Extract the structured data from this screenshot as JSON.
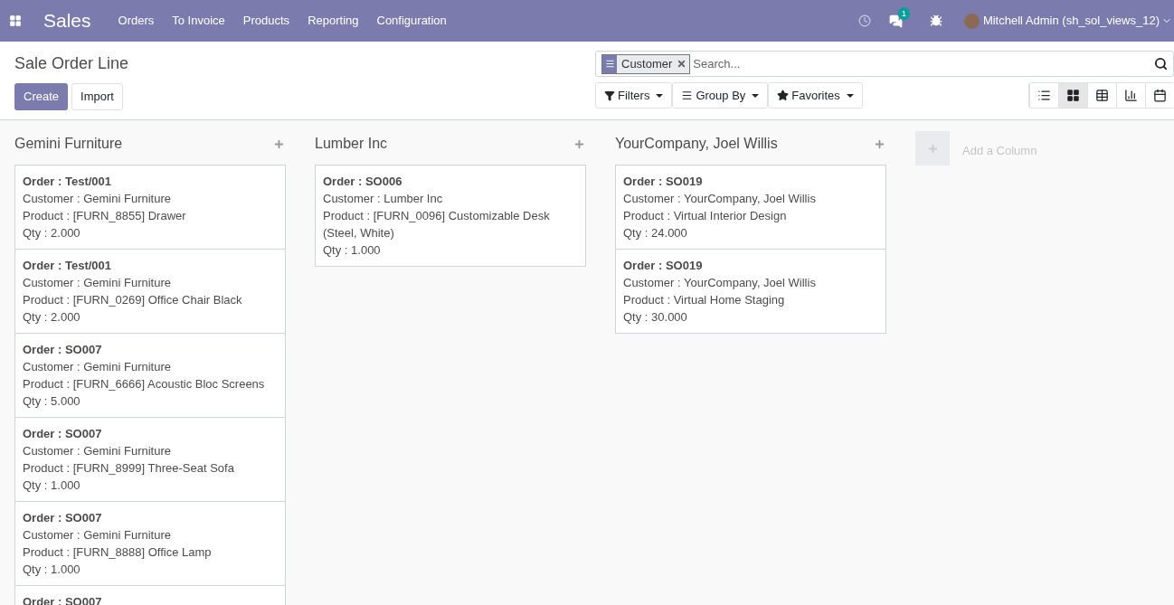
{
  "navbar": {
    "app": "Sales",
    "menu": [
      "Orders",
      "To Invoice",
      "Products",
      "Reporting",
      "Configuration"
    ],
    "messages_badge": "1",
    "user": "Mitchell Admin (sh_sol_views_12)"
  },
  "control_panel": {
    "title": "Sale Order Line",
    "buttons": [
      {
        "label": "Create",
        "kind": "primary"
      },
      {
        "label": "Import",
        "kind": "secondary"
      }
    ],
    "search": {
      "facets": [
        {
          "label": "Customer"
        }
      ],
      "placeholder": "Search..."
    },
    "dropdowns": [
      {
        "label": "Filters",
        "kind": "filter"
      },
      {
        "label": "Group By",
        "kind": "group"
      },
      {
        "label": "Favorites",
        "kind": "star"
      }
    ],
    "views": [
      {
        "kind": "list",
        "selected": false
      },
      {
        "kind": "kanban",
        "selected": true
      },
      {
        "kind": "pivot",
        "selected": false
      },
      {
        "kind": "graph",
        "selected": false
      },
      {
        "kind": "calendar",
        "selected": false
      }
    ]
  },
  "columns": [
    {
      "title": "Gemini Furniture",
      "cards": [
        {
          "order": "Order : Test/001",
          "lines": [
            "Customer : Gemini Furniture",
            "Product : [FURN_8855] Drawer",
            "Qty : 2.000"
          ]
        },
        {
          "order": "Order : Test/001",
          "lines": [
            "Customer : Gemini Furniture",
            "Product : [FURN_0269] Office Chair Black",
            "Qty : 2.000"
          ]
        },
        {
          "order": "Order : SO007",
          "lines": [
            "Customer : Gemini Furniture",
            "Product : [FURN_6666] Acoustic Bloc Screens",
            "Qty : 5.000"
          ]
        },
        {
          "order": "Order : SO007",
          "lines": [
            "Customer : Gemini Furniture",
            "Product : [FURN_8999] Three-Seat Sofa",
            "Qty : 1.000"
          ]
        },
        {
          "order": "Order : SO007",
          "lines": [
            "Customer : Gemini Furniture",
            "Product : [FURN_8888] Office Lamp",
            "Qty : 1.000"
          ]
        },
        {
          "order": "Order : SO007"
        }
      ]
    },
    {
      "title": "Lumber Inc",
      "cards": [
        {
          "order": "Order : SO006",
          "lines": [
            "Customer : Lumber Inc",
            "Product : [FURN_0096] Customizable Desk (Steel, White)",
            "Qty : 1.000"
          ]
        }
      ]
    },
    {
      "title": "YourCompany, Joel Willis",
      "cards": [
        {
          "order": "Order : SO019",
          "lines": [
            "Customer : YourCompany, Joel Willis",
            "Product : Virtual Interior Design",
            "Qty : 24.000"
          ]
        },
        {
          "order": "Order : SO019",
          "lines": [
            "Customer : YourCompany, Joel Willis",
            "Product : Virtual Home Staging",
            "Qty : 30.000"
          ]
        }
      ]
    }
  ],
  "add_column": "Add a Column"
}
